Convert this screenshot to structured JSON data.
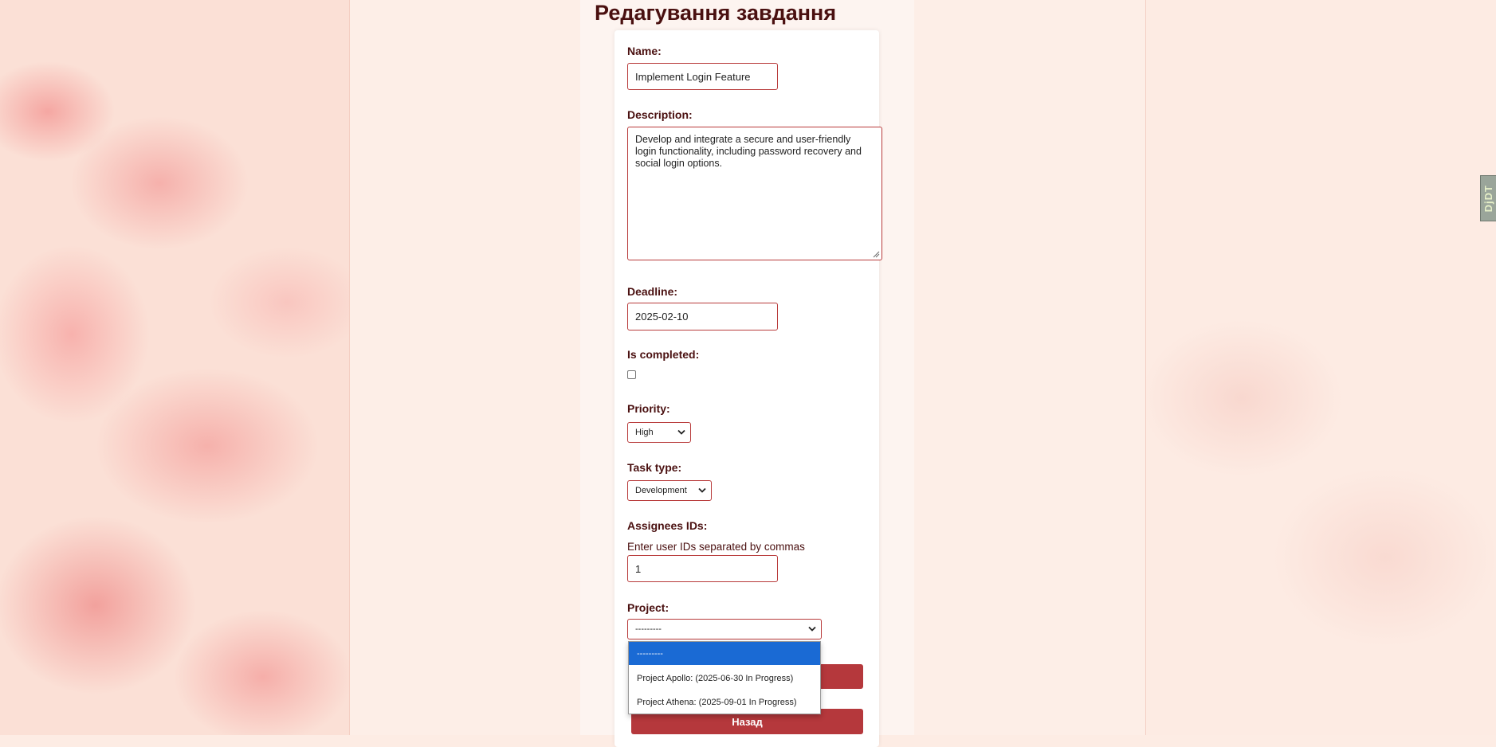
{
  "page": {
    "title": "Редагування завдання"
  },
  "form": {
    "name": {
      "label": "Name:",
      "value": "Implement Login Feature"
    },
    "description": {
      "label": "Description:",
      "value": "Develop and integrate a secure and user-friendly login functionality, including password recovery and social login options."
    },
    "deadline": {
      "label": "Deadline:",
      "value": "2025-02-10"
    },
    "is_completed": {
      "label": "Is completed:",
      "checked": false
    },
    "priority": {
      "label": "Priority:",
      "value": "High"
    },
    "task_type": {
      "label": "Task type:",
      "value": "Development"
    },
    "assignees": {
      "label": "Assignees IDs:",
      "help": "Enter user IDs separated by commas",
      "value": "1"
    },
    "project": {
      "label": "Project:",
      "value": "---------",
      "options": [
        "---------",
        "Project Apollo: (2025-06-30 In Progress)",
        "Project Athena: (2025-09-01 In Progress)"
      ],
      "selected_option": "---------"
    },
    "back_button": "Назад"
  },
  "side_tab": {
    "label": "DjDT"
  },
  "colors": {
    "accent": "#b5383c",
    "title": "#4a1010",
    "border": "#b83a3a",
    "highlight": "#1a6ad4"
  }
}
